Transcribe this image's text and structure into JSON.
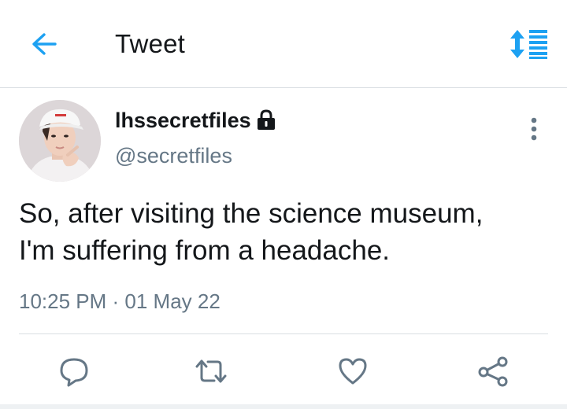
{
  "header": {
    "title": "Tweet",
    "back_icon": "arrow-left-icon",
    "sort_icon": "sort-toggle-icon"
  },
  "tweet": {
    "display_name": "lhssecretfiles",
    "protected_icon": "lock-icon",
    "handle": "@secretfiles",
    "text": "So, after visiting the science museum,\nI'm suffering from a headache.",
    "timestamp": "10:25 PM · 01 May 22"
  },
  "actions": [
    {
      "name": "reply",
      "icon": "reply-icon"
    },
    {
      "name": "retweet",
      "icon": "retweet-icon"
    },
    {
      "name": "like",
      "icon": "heart-icon"
    },
    {
      "name": "share",
      "icon": "share-icon"
    }
  ],
  "colors": {
    "accent": "#1da1f2",
    "text_primary": "#14171a",
    "text_secondary": "#657786",
    "divider": "#d9dee2"
  }
}
